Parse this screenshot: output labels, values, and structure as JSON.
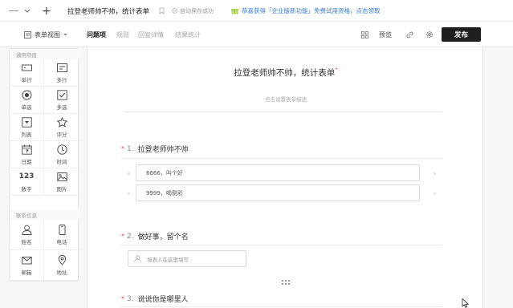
{
  "topbar": {
    "form_name": "拉登老师帅不帅，统计表单",
    "autosave": "自动保存成功",
    "promo": "恭喜获得「企业版新功能」免费试用资格，点击领取"
  },
  "toolbar": {
    "view_label": "表单视图",
    "tabs": [
      "问题项",
      "规则",
      "回复详情",
      "结果统计"
    ],
    "preview": "预览",
    "publish": "发布"
  },
  "palette": {
    "common_heading": "通用项目",
    "common_items": [
      {
        "label": "单行",
        "icon": "single-line-icon"
      },
      {
        "label": "多行",
        "icon": "multi-line-icon"
      },
      {
        "label": "单选",
        "icon": "radio-icon"
      },
      {
        "label": "多选",
        "icon": "checkbox-icon"
      },
      {
        "label": "列表",
        "icon": "dropdown-icon"
      },
      {
        "label": "评分",
        "icon": "star-icon"
      },
      {
        "label": "日期",
        "icon": "calendar-icon"
      },
      {
        "label": "时间",
        "icon": "clock-icon"
      },
      {
        "label": "数字",
        "icon": "number-icon",
        "glyph": "123"
      },
      {
        "label": "图片",
        "icon": "image-icon"
      }
    ],
    "contact_heading": "联系信息",
    "contact_items": [
      {
        "label": "姓名",
        "icon": "person-icon"
      },
      {
        "label": "电话",
        "icon": "phone-icon"
      },
      {
        "label": "邮箱",
        "icon": "mail-icon"
      },
      {
        "label": "地址",
        "icon": "location-icon"
      }
    ]
  },
  "form": {
    "title": "拉登老师帅不帅，统计表单",
    "description_placeholder": "点击设置表单描述",
    "questions": [
      {
        "number": "1.",
        "title": "拉登老师帅不帅",
        "options": [
          "6666，叫个好",
          "9999，喝倒彩"
        ]
      },
      {
        "number": "2.",
        "title": "做好事，留个名",
        "input_placeholder": "填表人在这里填写"
      },
      {
        "number": "3.",
        "title": "说说你是哪里人"
      }
    ]
  },
  "colors": {
    "publish_bg": "#1f1f1f",
    "required_star": "#e8484a",
    "promo_icon": "#7cb518"
  }
}
